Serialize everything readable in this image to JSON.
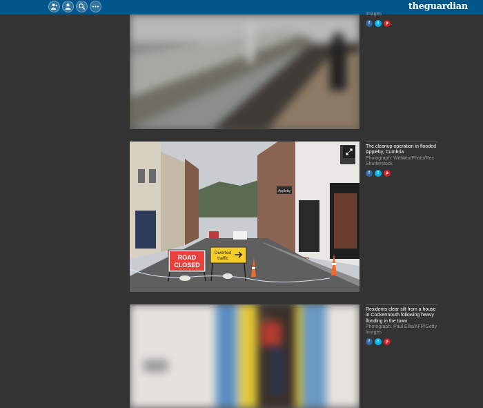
{
  "header": {
    "brand": "theguardian",
    "brand_prefix": "the",
    "brand_suffix": "guardian",
    "nav_icons": [
      "subscribe-icon",
      "profile-icon",
      "search-icon",
      "more-icon"
    ],
    "bg_color": "#005689"
  },
  "gallery": {
    "items": [
      {
        "caption": "",
        "credit": "Images",
        "share": [
          "facebook-icon",
          "twitter-icon",
          "pinterest-icon"
        ]
      },
      {
        "caption": "The cleanup operation in flooded Appleby, Cumbria",
        "credit": "Photograph: WittWooPhoto/Rex Shutterstock",
        "share": [
          "facebook-icon",
          "twitter-icon",
          "pinterest-icon"
        ],
        "signs": {
          "road_closed_line1": "ROAD",
          "road_closed_line2": "CLOSED",
          "diverted_line1": "Diverted",
          "diverted_line2": "traffic",
          "shop_name": "Appleby"
        }
      },
      {
        "caption": "Residents clear silt from a house in Cockermouth following heavy flooding in the town",
        "credit": "Photograph: Paul Ellis/AFP/Getty Images",
        "share": [
          "facebook-icon",
          "twitter-icon",
          "pinterest-icon"
        ]
      }
    ]
  },
  "colors": {
    "page_bg": "#333333",
    "fb": "#3067a3",
    "tw": "#03b3ee",
    "pin": "#cc2127",
    "credit": "#9a9a9a"
  }
}
